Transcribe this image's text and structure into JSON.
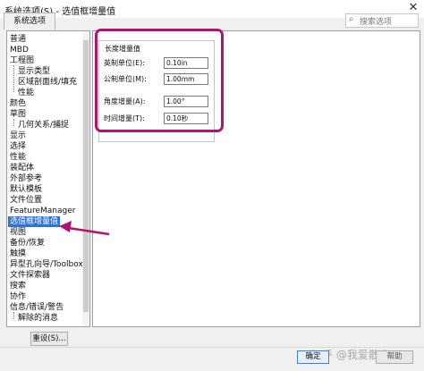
{
  "window": {
    "title": "系统选项(S) - 选值框增量值",
    "close_glyph": "✕"
  },
  "tab_label": "系统选项",
  "search": {
    "placeholder": "搜索选项",
    "icon": "search-icon"
  },
  "tree": [
    {
      "label": "普通"
    },
    {
      "label": "MBD"
    },
    {
      "label": "工程图"
    },
    {
      "label": "显示类型"
    },
    {
      "label": "区域剖面线/填充"
    },
    {
      "label": "性能"
    },
    {
      "label": "颜色"
    },
    {
      "label": "草图"
    },
    {
      "label": "几何关系/捕捉"
    },
    {
      "label": "显示"
    },
    {
      "label": "选择"
    },
    {
      "label": "性能"
    },
    {
      "label": "装配体"
    },
    {
      "label": "外部参考"
    },
    {
      "label": "默认模板"
    },
    {
      "label": "文件位置"
    },
    {
      "label": "FeatureManager"
    },
    {
      "label": "选值框增量值"
    },
    {
      "label": "视图"
    },
    {
      "label": "备份/恢复"
    },
    {
      "label": "触摸"
    },
    {
      "label": "异型孔向导/Toolbox"
    },
    {
      "label": "文件探索器"
    },
    {
      "label": "搜索"
    },
    {
      "label": "协作"
    },
    {
      "label": "信息/错误/警告"
    },
    {
      "label": "解除的消息"
    }
  ],
  "group": {
    "title": "长度增量值",
    "fields": [
      {
        "label": "英制单位(E):",
        "value": "0.10in"
      },
      {
        "label": "公制单位(M):",
        "value": "1.00mm"
      },
      {
        "label": "角度增量(A):",
        "value": "1.00°"
      },
      {
        "label": "时间增量(T):",
        "value": "0.10秒"
      }
    ]
  },
  "buttons": {
    "reset": "重设(S)...",
    "ok": "确定",
    "cancel": "帮助"
  },
  "watermark": "知乎 @我爱散步",
  "colors": {
    "highlight": "#b0156e",
    "selected": "#2f70d5",
    "arrow": "#b0156e"
  }
}
